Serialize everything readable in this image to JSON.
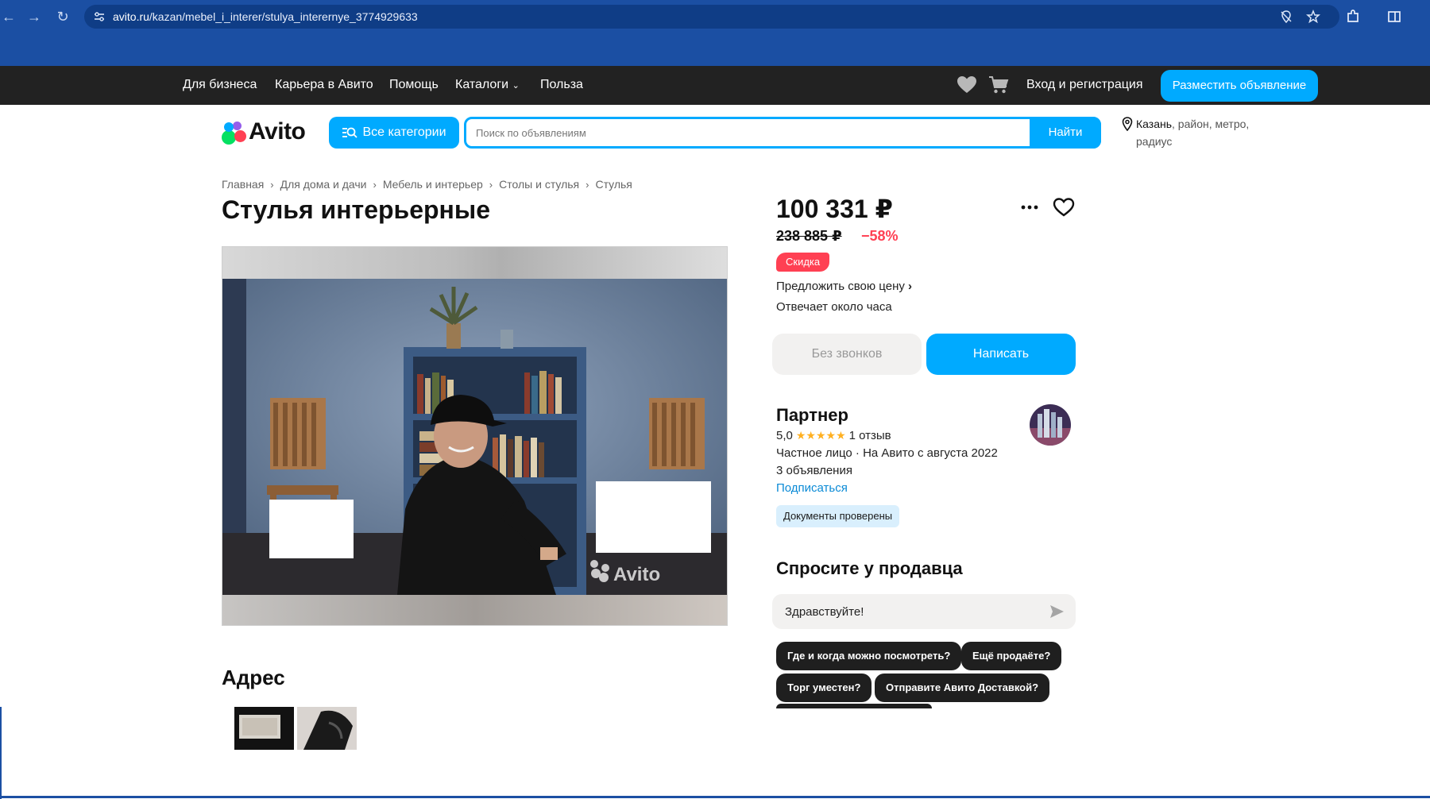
{
  "browser": {
    "url_domain": "avito.ru",
    "url_path": "/kazan/mebel_i_interer/stulya_interernye_3774929633"
  },
  "topnav": {
    "links": [
      "Для бизнеса",
      "Карьера в Авито",
      "Помощь",
      "Каталоги",
      "Польза"
    ],
    "login": "Вход и регистрация",
    "post_button": "Разместить объявление"
  },
  "header": {
    "logo_text": "Avito",
    "categories_button": "Все категории",
    "search_placeholder": "Поиск по объявлениям",
    "search_button": "Найти",
    "location_city": "Казань",
    "location_rest": ", район, метро, радиус"
  },
  "breadcrumb": [
    "Главная",
    "Для дома и дачи",
    "Мебель и интерьер",
    "Столы и стулья",
    "Стулья"
  ],
  "listing": {
    "title": "Стулья интерьерные",
    "watermark": "Avito",
    "address_title": "Адрес"
  },
  "pricing": {
    "price": "100 331 ₽",
    "old_price": "238 885 ₽",
    "discount": "−58%",
    "badge": "Скидка",
    "offer_link": "Предложить свою цену",
    "reply_time": "Отвечает около часа",
    "no_calls_button": "Без звонков",
    "write_button": "Написать"
  },
  "seller": {
    "name": "Партнер",
    "rating": "5,0",
    "stars": "★★★★★",
    "reviews": "1 отзыв",
    "type": "Частное лицо · На Авито с августа 2022",
    "listings_count": "3 объявления",
    "subscribe": "Подписаться",
    "verified_badge": "Документы проверены"
  },
  "ask": {
    "title": "Спросите у продавца",
    "input_value": "Здравствуйте!",
    "chips": [
      "Где и когда можно посмотреть?",
      "Ещё продаёте?",
      "Торг уместен?",
      "Отправите Авито Доставкой?"
    ]
  },
  "colors": {
    "accent": "#00aaff",
    "discount": "#ff4053",
    "browser": "#1b4fa3",
    "topnav": "#222222"
  }
}
